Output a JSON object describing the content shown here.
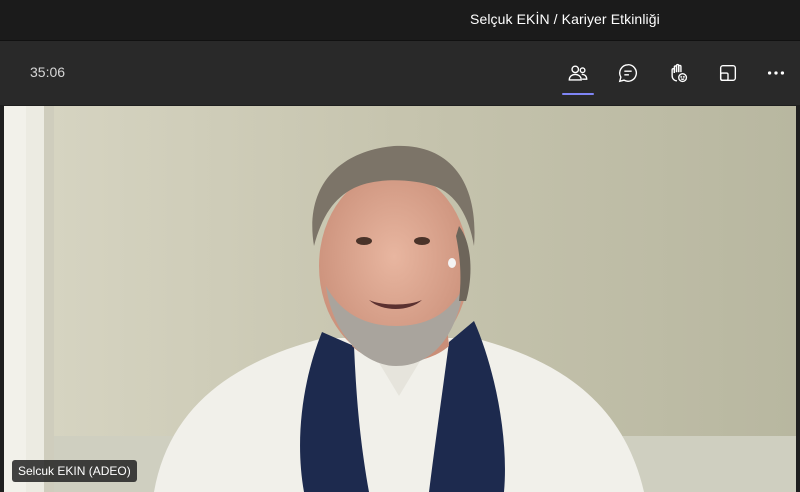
{
  "window": {
    "title": "Selçuk EKİN / Kariyer Etkinliği"
  },
  "toolbar": {
    "timer": "35:06",
    "buttons": [
      {
        "icon": "people-icon",
        "label": "Participants",
        "active": true
      },
      {
        "icon": "chat-icon",
        "label": "Chat",
        "active": false
      },
      {
        "icon": "raise-hand-icon",
        "label": "Raise hand",
        "active": false
      },
      {
        "icon": "share-view-icon",
        "label": "View",
        "active": false
      },
      {
        "icon": "more-icon",
        "label": "More actions",
        "active": false
      }
    ]
  },
  "video": {
    "participant_name": "Selcuk EKIN (ADEO)"
  },
  "colors": {
    "accent": "#7f85f5",
    "titlebar": "#1b1b1b",
    "toolbar": "#292929"
  }
}
